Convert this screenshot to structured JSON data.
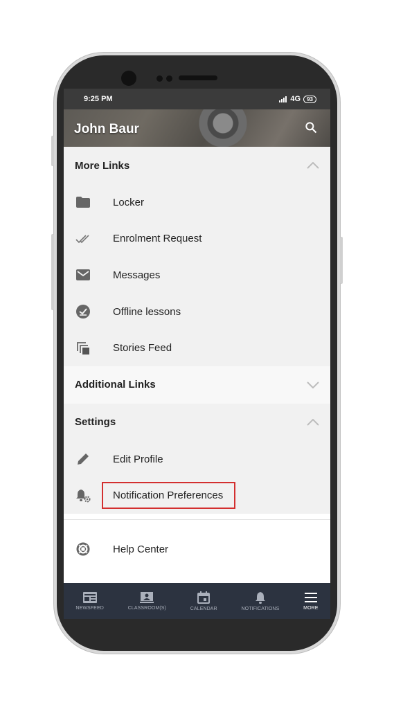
{
  "status_bar": {
    "time": "9:25 PM",
    "signal": "4G",
    "battery": "93"
  },
  "header": {
    "title": "John Baur",
    "search_icon": "search-icon"
  },
  "sections": {
    "more_links": {
      "title": "More Links",
      "items": [
        {
          "label": "Locker",
          "icon": "folder-icon"
        },
        {
          "label": "Enrolment Request",
          "icon": "double-check-icon"
        },
        {
          "label": "Messages",
          "icon": "envelope-icon"
        },
        {
          "label": "Offline lessons",
          "icon": "offline-check-icon"
        },
        {
          "label": "Stories Feed",
          "icon": "stacked-pages-icon"
        }
      ]
    },
    "additional_links": {
      "title": "Additional Links"
    },
    "settings": {
      "title": "Settings",
      "items": [
        {
          "label": "Edit Profile",
          "icon": "pencil-icon"
        },
        {
          "label": "Notification Preferences",
          "icon": "bell-gear-icon",
          "highlight_color": "#d32f2f"
        }
      ]
    }
  },
  "help": {
    "label": "Help Center",
    "icon": "lifebuoy-icon"
  },
  "bottom_nav": [
    {
      "label": "NEWSFEED",
      "icon": "newspaper-icon"
    },
    {
      "label": "CLASSROOM(S)",
      "icon": "classroom-icon"
    },
    {
      "label": "CALENDAR",
      "icon": "calendar-icon"
    },
    {
      "label": "NOTIFICATIONS",
      "icon": "bell-icon"
    },
    {
      "label": "MORE",
      "icon": "menu-icon",
      "active": true
    }
  ],
  "colors": {
    "nav_bg": "#2c3340",
    "highlight": "#d32f2f",
    "status_bg": "#3b3b3b"
  }
}
